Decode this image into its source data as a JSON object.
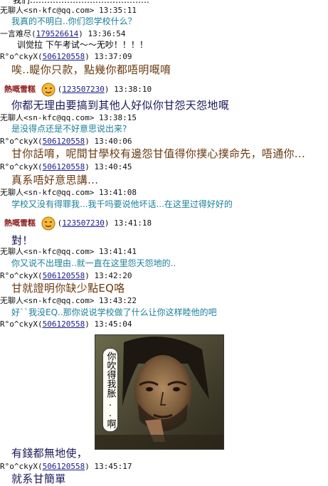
{
  "messages": [
    {
      "id": "m0",
      "type": "text",
      "style": "black",
      "text": "我们……………………………………"
    },
    {
      "id": "h1",
      "type": "header",
      "nick": "无聊人<sn-kfc@qq.com>",
      "time": "13:35:11"
    },
    {
      "id": "t1",
      "type": "text",
      "style": "teal",
      "text": "我真的不明白..你们怨学校什么？"
    },
    {
      "id": "h2",
      "type": "header",
      "nick": "一言难尽",
      "qq": "179526614",
      "time": "13:36:54"
    },
    {
      "id": "t2",
      "type": "text",
      "style": "black",
      "text": "训觉拉  下午考试～～无吵！！！！"
    },
    {
      "id": "h3",
      "type": "header",
      "nick": "R°o^ckyX",
      "qq": "506120558",
      "time": "13:37:09"
    },
    {
      "id": "t3",
      "type": "text",
      "style": "brown",
      "text": "唉..睼你只款，點幾你都唔明嘅唷"
    },
    {
      "id": "h4",
      "type": "header",
      "nick": "熱嘅雪糕",
      "qq": "123507230",
      "time": "13:38:10",
      "smiley": true
    },
    {
      "id": "t4",
      "type": "text",
      "style": "dark",
      "text": "你都无理由要搞到其他人好似你甘怨天怨地嘅"
    },
    {
      "id": "h5",
      "type": "header",
      "nick": "无聊人<sn-kfc@qq.com>",
      "time": "13:38:15"
    },
    {
      "id": "t5",
      "type": "text",
      "style": "teal",
      "text": "是没得点还是不好意思说出来?"
    },
    {
      "id": "h6",
      "type": "header",
      "nick": "R°o^ckyX",
      "qq": "506120558",
      "time": "13:40:06"
    },
    {
      "id": "t6",
      "type": "text",
      "style": "brown",
      "text": "甘你話唷，呢間甘學校有邊怨甘值得你撲心撲命先，唔通你..."
    },
    {
      "id": "h7",
      "type": "header",
      "nick": "R°o^ckyX",
      "qq": "506120558",
      "time": "13:40:45"
    },
    {
      "id": "t7",
      "type": "text",
      "style": "brown",
      "text": "真系唔好意思講..."
    },
    {
      "id": "h8",
      "type": "header",
      "nick": "无聊人<sn-kfc@qq.com>",
      "time": "13:41:08"
    },
    {
      "id": "t8",
      "type": "text",
      "style": "teal",
      "text": "学校又没有得罪我...我千吗要说他坏话...在这里过得好好的"
    },
    {
      "id": "h9",
      "type": "header",
      "nick": "熱嘅雪糕",
      "qq": "123507230",
      "time": "13:41:18",
      "smiley": true
    },
    {
      "id": "t9",
      "type": "text",
      "style": "dark",
      "text": "對！"
    },
    {
      "id": "h10",
      "type": "header",
      "nick": "无聊人<sn-kfc@qq.com>",
      "time": "13:41:41"
    },
    {
      "id": "t10",
      "type": "text",
      "style": "teal",
      "text": "你又说不出理由..就一直在这里怨天怨地的.."
    },
    {
      "id": "h11",
      "type": "header",
      "nick": "R°o^ckyX",
      "qq": "506120558",
      "time": "13:42:20"
    },
    {
      "id": "t11",
      "type": "text",
      "style": "brown",
      "text": "甘就證明你缺少點EQ咯"
    },
    {
      "id": "h12",
      "type": "header",
      "nick": "无聊人<sn-kfc@qq.com>",
      "time": "13:43:22"
    },
    {
      "id": "t12",
      "type": "text",
      "style": "teal",
      "text": "好``我没EQ..那你说说学校做了什么让你这样睦他的吧"
    },
    {
      "id": "h13",
      "type": "header",
      "nick": "R°o^ckyX",
      "qq": "506120558",
      "time": "13:45:04"
    },
    {
      "id": "t14",
      "type": "text",
      "style": "dark",
      "text": "有錢都無地使，"
    },
    {
      "id": "h15",
      "type": "header",
      "nick": "R°o^ckyX",
      "qq": "506120558",
      "time": "13:45:17"
    },
    {
      "id": "t15",
      "type": "text",
      "style": "dark",
      "text": "就系甘簡單"
    }
  ],
  "image_caption": "你吹得我胀..啊",
  "colors": {
    "teal": "#1a7f9a",
    "qq_link": "#1a1a8c",
    "brown": "#6b3a10",
    "dark": "#1a1a5a"
  }
}
